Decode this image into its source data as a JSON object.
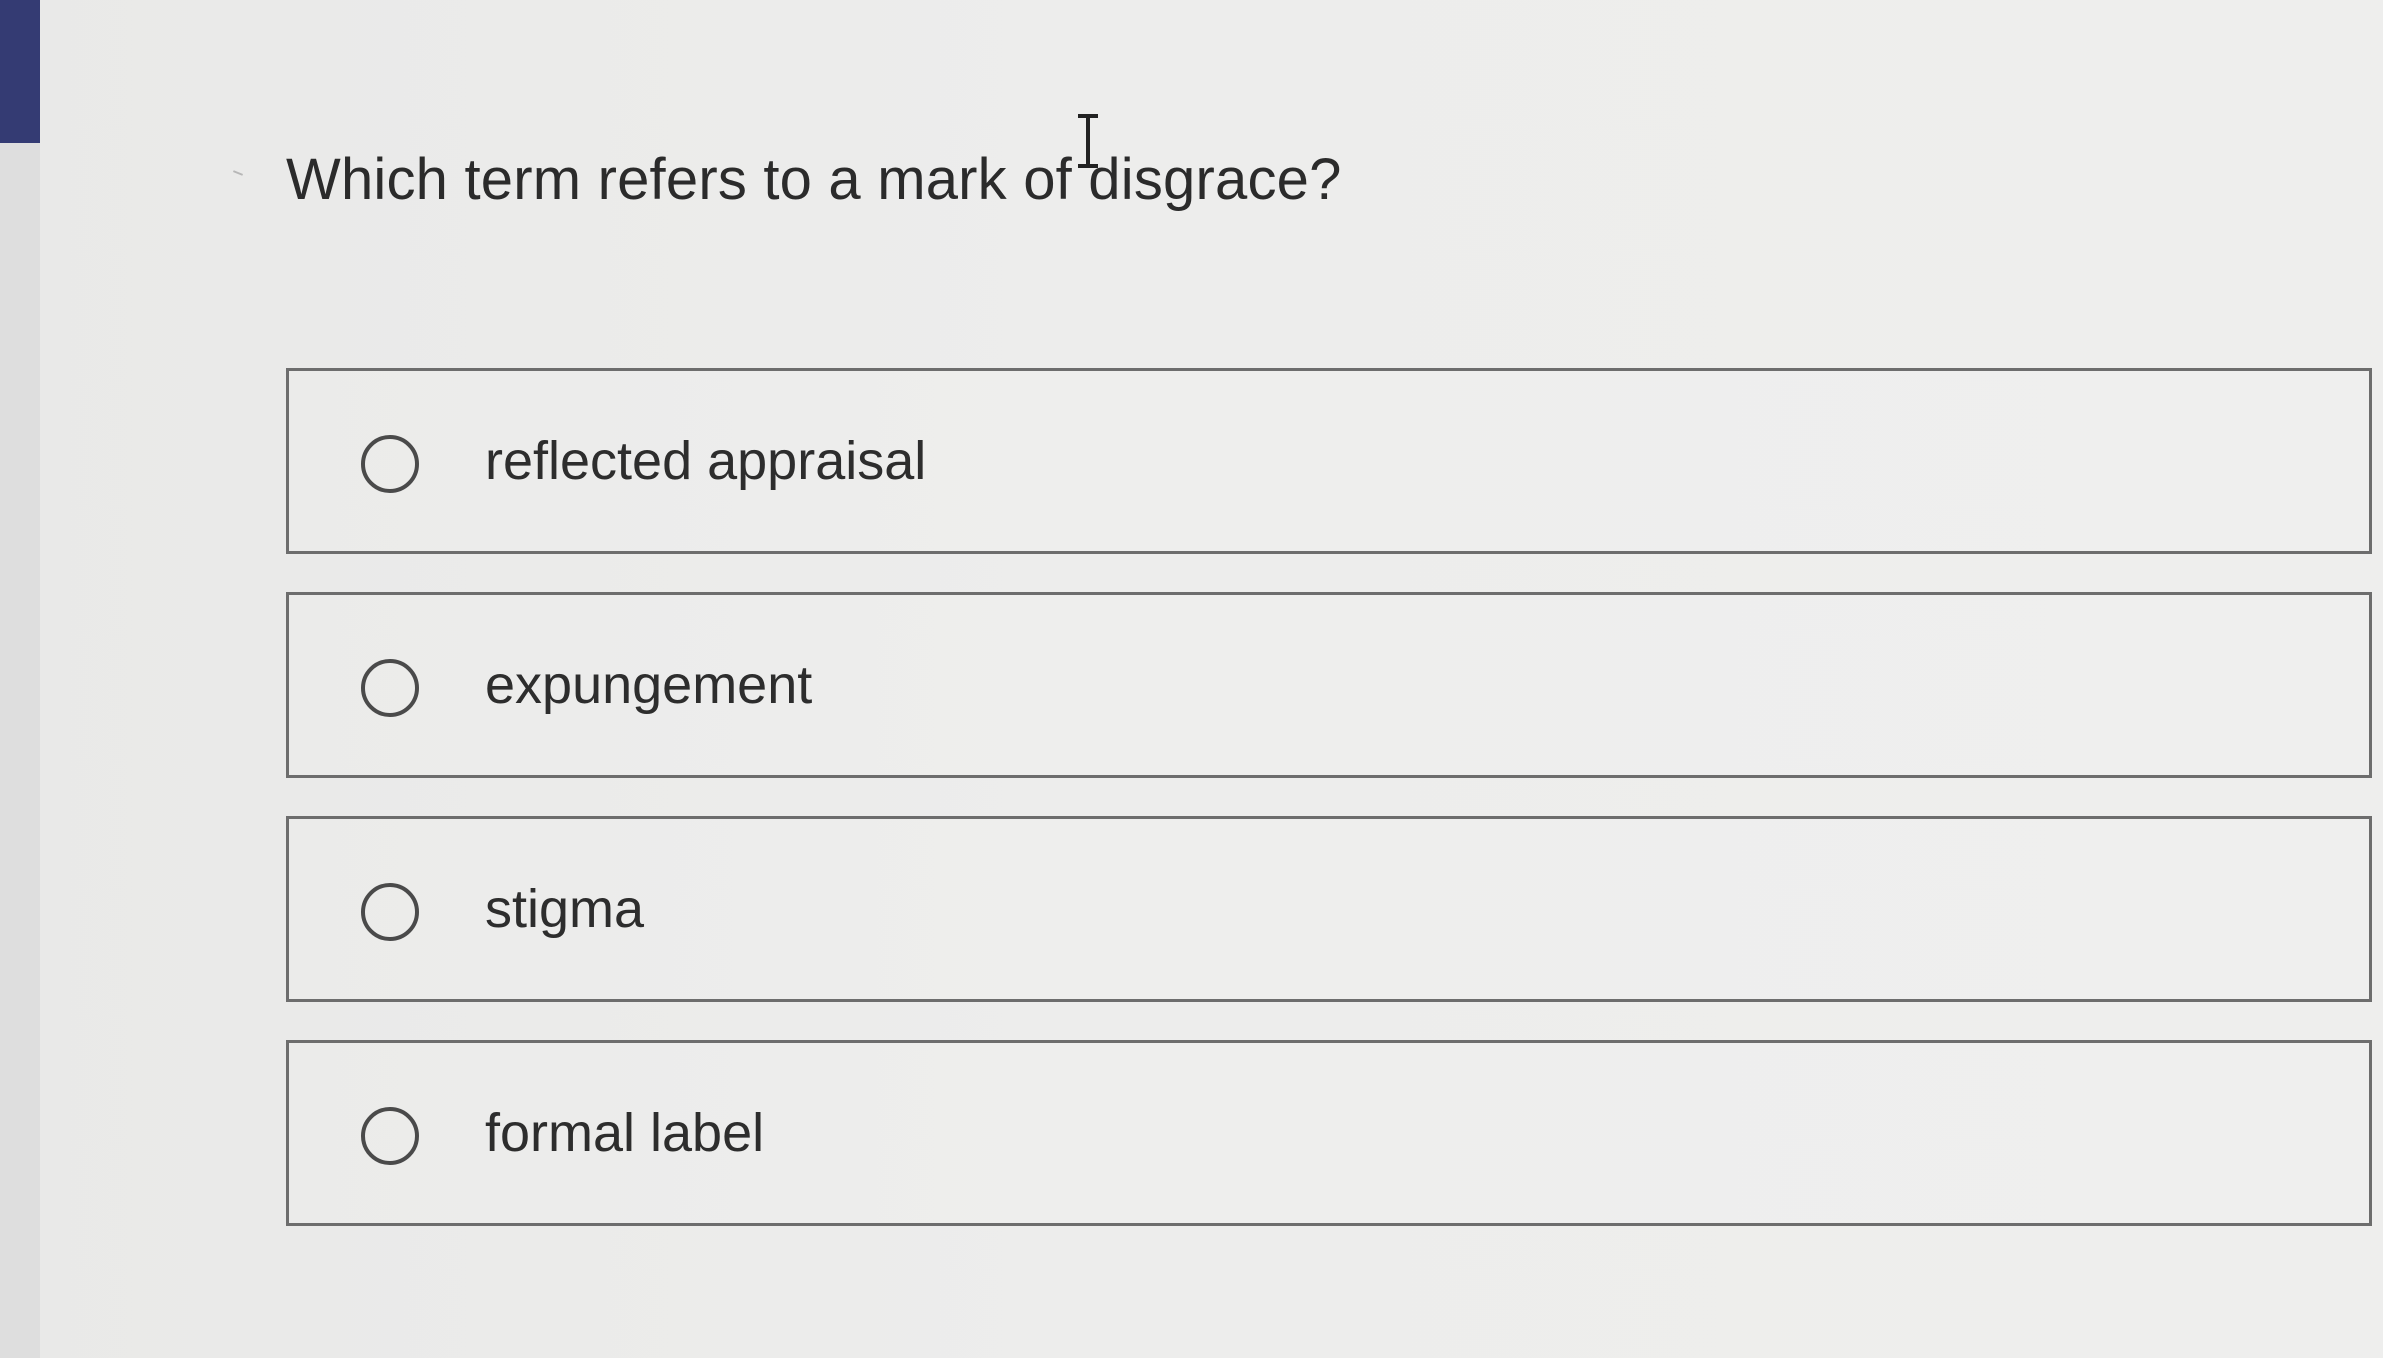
{
  "colors": {
    "background": "#ececec",
    "text": "#2b2b2b",
    "border": "#6d6d6d",
    "left_accent": "#343b73"
  },
  "question": {
    "text": "Which term refers to a mark of disgrace?"
  },
  "choices": [
    {
      "label": "reflected appraisal",
      "selected": false
    },
    {
      "label": "expungement",
      "selected": false
    },
    {
      "label": "stigma",
      "selected": false
    },
    {
      "label": "formal label",
      "selected": false
    }
  ],
  "icons": {
    "cursor": "text-cursor-icon",
    "radio": "radio-button-icon"
  }
}
